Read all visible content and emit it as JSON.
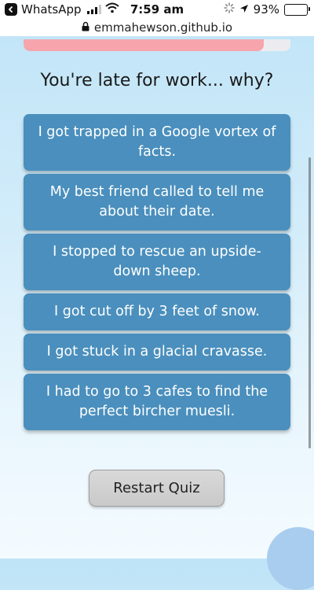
{
  "status_bar": {
    "app_name": "WhatsApp",
    "time": "7:59 am",
    "battery_percent": "93%",
    "battery_level": 0.93,
    "signal_bars": 3,
    "icons": [
      "back-icon",
      "signal-icon",
      "wifi-icon",
      "loading-icon",
      "location-arrow-icon",
      "battery-icon"
    ]
  },
  "browser": {
    "url": "emmahewson.github.io",
    "lock_icon": "lock-icon"
  },
  "quiz": {
    "progress_fraction": 0.9,
    "progress_color": "#f6a5ac",
    "question": "You're late for work... why?",
    "answers": [
      "I got trapped in a Google vortex of facts.",
      "My best friend called to tell me about their date.",
      "I stopped to rescue an upside-down sheep.",
      "I got cut off by 3 feet of snow.",
      "I got stuck in a glacial cravasse.",
      "I had to go to 3 cafes to find the perfect bircher muesli."
    ],
    "answer_color": "#4a8fbd",
    "restart_label": "Restart Quiz"
  }
}
